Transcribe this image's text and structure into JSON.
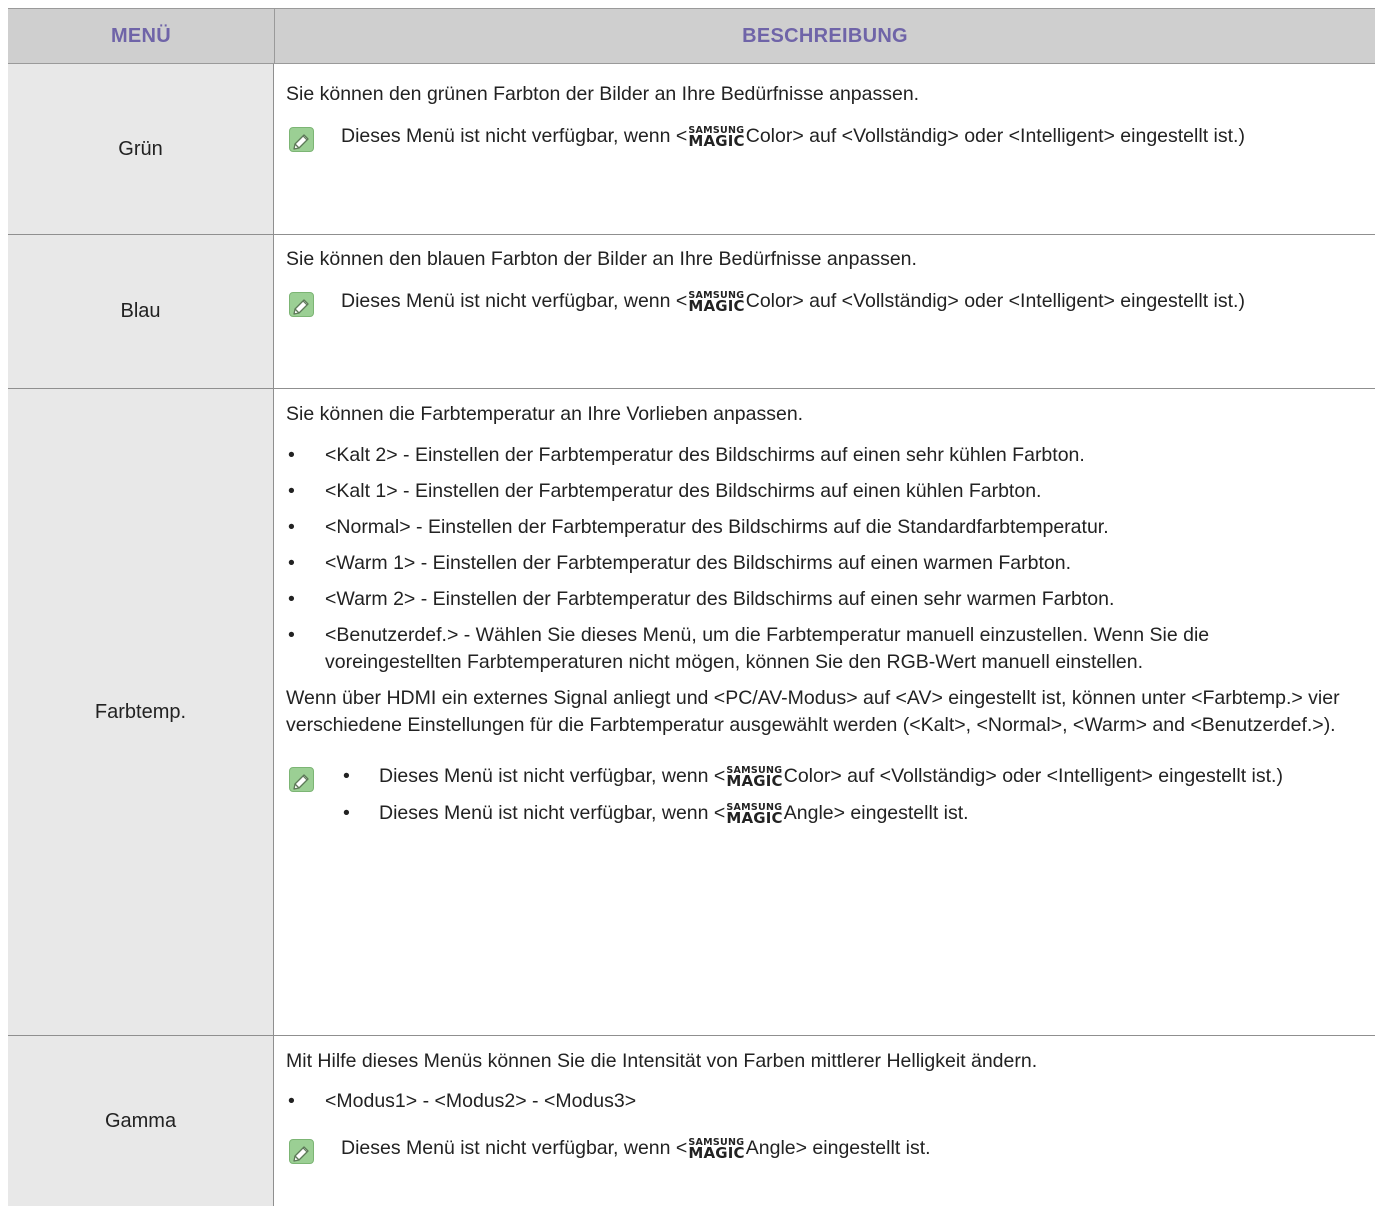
{
  "header": {
    "menu": "MENÜ",
    "description": "BESCHREIBUNG"
  },
  "magic_logo": {
    "top": "SAMSUNG",
    "bottom": "MAGIC"
  },
  "rows": [
    {
      "menu": "Grün",
      "intro": "Sie können den grünen Farbton der Bilder an Ihre Bedürfnisse anpassen.",
      "note": {
        "before": "Dieses Menü ist nicht verfügbar, wenn <",
        "after": "Color> auf <Vollständig> oder <Intelligent> eingestellt ist.)"
      }
    },
    {
      "menu": "Blau",
      "intro": "Sie können den blauen Farbton der Bilder an Ihre Bedürfnisse anpassen.",
      "note": {
        "before": "Dieses Menü ist nicht verfügbar, wenn <",
        "after": "Color> auf <Vollständig> oder <Intelligent> eingestellt ist.)"
      }
    },
    {
      "menu": "Farbtemp.",
      "intro": "Sie können die Farbtemperatur an Ihre Vorlieben anpassen.",
      "bullets": [
        "<Kalt 2> - Einstellen der Farbtemperatur des Bildschirms auf einen sehr kühlen Farbton.",
        "<Kalt 1> - Einstellen der Farbtemperatur des Bildschirms auf einen kühlen Farbton.",
        "<Normal> - Einstellen der Farbtemperatur des Bildschirms auf die Standardfarbtemperatur.",
        "<Warm 1> - Einstellen der Farbtemperatur des Bildschirms auf einen warmen Farbton.",
        "<Warm 2> - Einstellen der Farbtemperatur des Bildschirms auf einen sehr warmen Farbton.",
        "<Benutzerdef.> - Wählen Sie dieses Menü, um die Farbtemperatur manuell einzustellen. Wenn Sie die voreingestellten Farbtemperaturen nicht mögen, können Sie den RGB-Wert manuell einstellen."
      ],
      "paragraph": "Wenn über HDMI ein externes Signal anliegt und <PC/AV-Modus> auf <AV> eingestellt ist, können unter <Farbtemp.> vier verschiedene Einstellungen für die Farbtemperatur ausgewählt werden (<Kalt>, <Normal>, <Warm> and <Benutzerdef.>).",
      "notes": [
        {
          "before": "Dieses Menü ist nicht verfügbar, wenn <",
          "after": "Color> auf <Vollständig> oder <Intelligent> eingestellt ist.)"
        },
        {
          "before": "Dieses Menü ist nicht verfügbar, wenn <",
          "after": "Angle> eingestellt ist."
        }
      ]
    },
    {
      "menu": "Gamma",
      "intro": "Mit Hilfe dieses Menüs können Sie die Intensität von Farben mittlerer Helligkeit ändern.",
      "bullets": [
        "<Modus1> - <Modus2> - <Modus3>"
      ],
      "note": {
        "before": "Dieses Menü ist nicht verfügbar, wenn <",
        "after": "Angle> eingestellt ist."
      }
    }
  ]
}
